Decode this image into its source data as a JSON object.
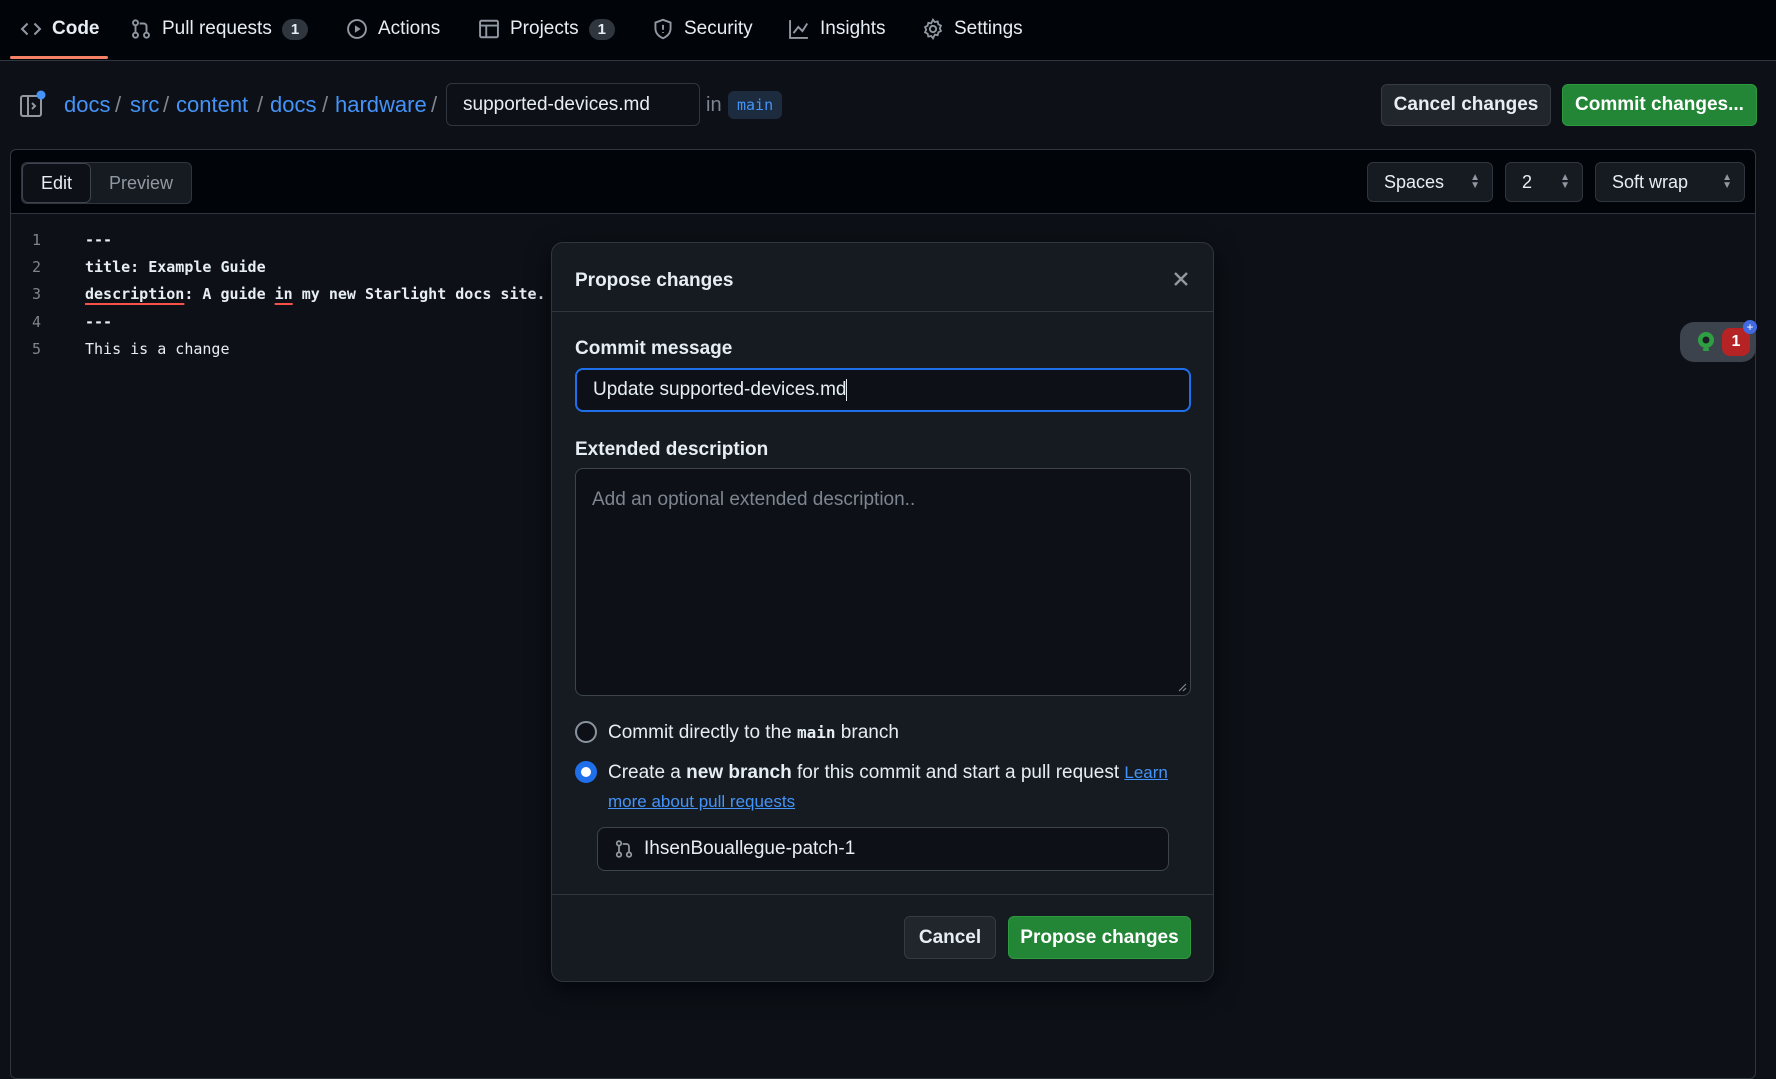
{
  "nav": {
    "tabs": [
      {
        "label": "Code",
        "icon": "code-icon"
      },
      {
        "label": "Pull requests",
        "count": "1",
        "icon": "git-pull-request-icon"
      },
      {
        "label": "Actions",
        "icon": "play-icon"
      },
      {
        "label": "Projects",
        "count": "1",
        "icon": "table-icon"
      },
      {
        "label": "Security",
        "icon": "shield-icon"
      },
      {
        "label": "Insights",
        "icon": "graph-icon"
      },
      {
        "label": "Settings",
        "icon": "gear-icon"
      }
    ]
  },
  "breadcrumb": {
    "segments": [
      "docs",
      "src",
      "content",
      "docs",
      "hardware"
    ],
    "separator": "/",
    "filename": "supported-devices.md",
    "in_text": "in",
    "branch": "main"
  },
  "header_actions": {
    "cancel_label": "Cancel changes",
    "commit_label": "Commit changes..."
  },
  "editor": {
    "modes": [
      "Edit",
      "Preview"
    ],
    "active_mode": "Edit",
    "indent_mode": "Spaces",
    "indent_size": "2",
    "wrap_mode": "Soft wrap",
    "lines": [
      {
        "n": "1",
        "text": "---"
      },
      {
        "n": "2",
        "text": "title: Example Guide"
      },
      {
        "n": "3",
        "text": "description: A guide in my new Starlight docs site."
      },
      {
        "n": "4",
        "text": "---"
      },
      {
        "n": "5",
        "text": "This is a change"
      }
    ]
  },
  "extension_badge": {
    "count": "1"
  },
  "modal": {
    "title": "Propose changes",
    "commit_message_label": "Commit message",
    "commit_message_value": "Update supported-devices.md",
    "extended_label": "Extended description",
    "extended_placeholder": "Add an optional extended description..",
    "option_direct": {
      "before": "Commit directly to the ",
      "branch": "main",
      "after": " branch",
      "selected": false
    },
    "option_branch": {
      "before": "Create a ",
      "bold": "new branch",
      "after": " for this commit and start a pull request ",
      "link": "Learn more about pull requests",
      "selected": true
    },
    "new_branch_name": "IhsenBouallegue-patch-1",
    "cancel_label": "Cancel",
    "submit_label": "Propose changes"
  },
  "colors": {
    "background": "#0d1117",
    "accent_green": "#238636",
    "link_blue": "#4493f8",
    "tab_underline": "#f78166"
  }
}
